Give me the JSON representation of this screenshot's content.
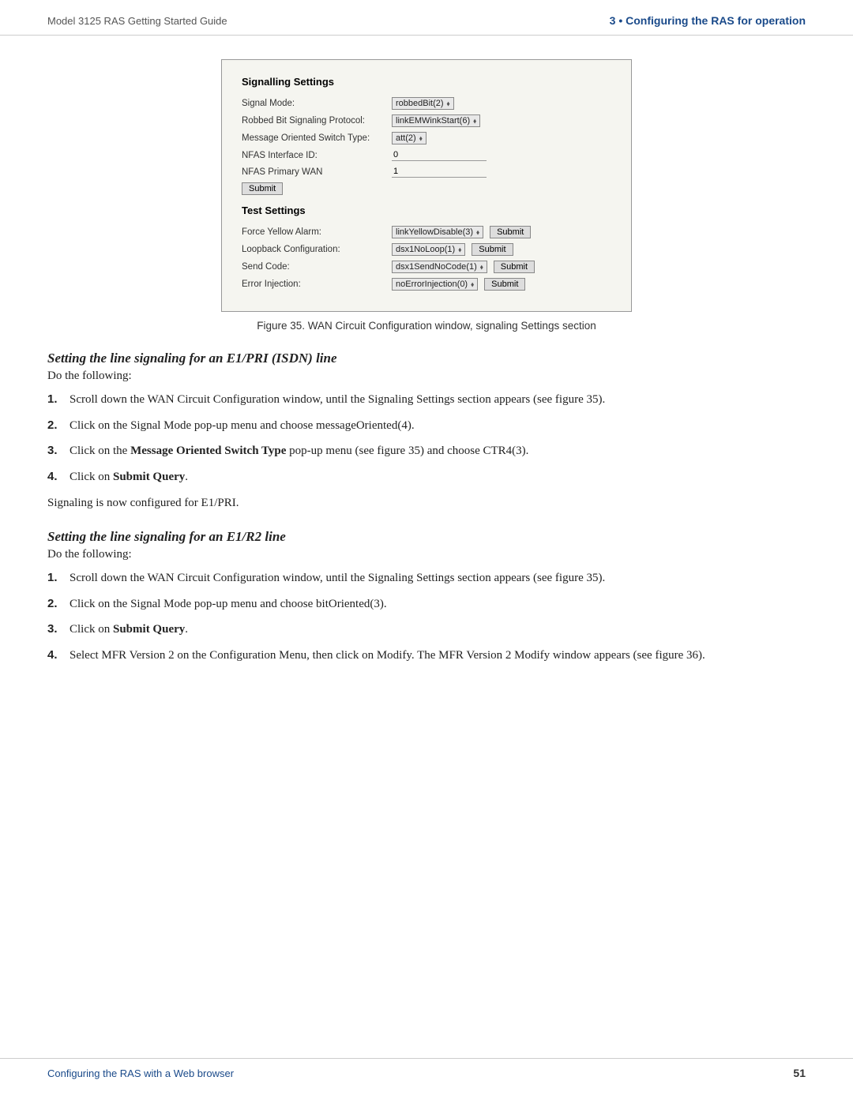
{
  "header": {
    "left": "Model 3125 RAS Getting Started Guide",
    "right": "3  •  Configuring the RAS for operation"
  },
  "figure": {
    "caption": "Figure 35. WAN Circuit Configuration window, signaling Settings section",
    "screenshot": {
      "signalling_settings_title": "Signalling Settings",
      "fields": [
        {
          "label": "Signal Mode:",
          "type": "select",
          "value": "robbedBit(2)"
        },
        {
          "label": "Robbed Bit Signaling Protocol:",
          "type": "select",
          "value": "linkEMWinkStart(6)"
        },
        {
          "label": "Message Oriented Switch Type:",
          "type": "select",
          "value": "att(2)"
        },
        {
          "label": "NFAS Interface ID:",
          "type": "text",
          "value": "0"
        },
        {
          "label": "NFAS Primary WAN",
          "type": "text",
          "value": "1"
        }
      ],
      "submit_label": "Submit",
      "test_settings_title": "Test Settings",
      "test_fields": [
        {
          "label": "Force Yellow Alarm:",
          "type": "select",
          "value": "linkYellowDisable(3)",
          "submit": "Submit"
        },
        {
          "label": "Loopback Configuration:",
          "type": "select",
          "value": "dsx1NoLoop(1)",
          "submit": "Submit"
        },
        {
          "label": "Send Code:",
          "type": "select",
          "value": "dsx1SendNoCode(1)",
          "submit": "Submit"
        },
        {
          "label": "Error Injection:",
          "type": "select",
          "value": "noErrorInjection(0)",
          "submit": "Submit"
        }
      ]
    }
  },
  "section1": {
    "heading": "Setting the line signaling for an E1/PRI (ISDN) line",
    "do_following": "Do the following:",
    "steps": [
      {
        "num": "1.",
        "text": "Scroll down the WAN Circuit Configuration window, until the Signaling Settings section appears (see figure 35)."
      },
      {
        "num": "2.",
        "text": "Click on the Signal Mode pop-up menu and choose messageOriented(4)."
      },
      {
        "num": "3.",
        "text": "Click on the Message Oriented Switch Type pop-up menu (see figure 35) and choose CTR4(3)."
      },
      {
        "num": "4.",
        "text_plain": "Click on ",
        "text_bold": "Submit Query",
        "text_end": ".",
        "bold_item": true
      }
    ],
    "signaling_note": "Signaling is now configured for E1/PRI."
  },
  "section2": {
    "heading": "Setting the line signaling for an E1/R2 line",
    "do_following": "Do the following:",
    "steps": [
      {
        "num": "1.",
        "text": "Scroll down the WAN Circuit Configuration window, until the Signaling Settings section appears (see figure 35)."
      },
      {
        "num": "2.",
        "text": "Click on the Signal Mode pop-up menu and choose bitOriented(3)."
      },
      {
        "num": "3.",
        "text_plain": "Click on ",
        "text_bold": "Submit Query",
        "text_end": ".",
        "bold_item": true
      },
      {
        "num": "4.",
        "text": "Select MFR Version 2 on the Configuration Menu, then click on Modify. The MFR Version 2 Modify window appears (see figure 36)."
      }
    ]
  },
  "footer": {
    "left": "Configuring the RAS with a Web browser",
    "right": "51"
  }
}
